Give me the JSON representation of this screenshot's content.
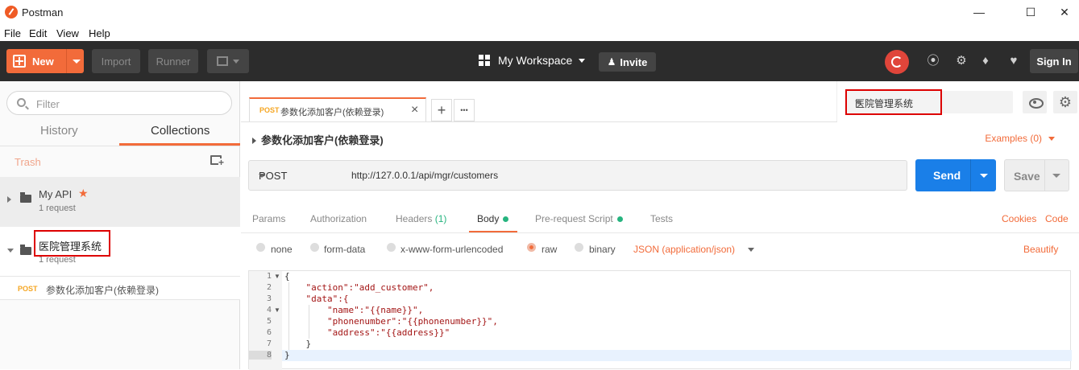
{
  "window": {
    "title": "Postman",
    "minimize_glyph": "—",
    "maximize_glyph": "☐",
    "close_glyph": "✕"
  },
  "menu": {
    "items": [
      "File",
      "Edit",
      "View",
      "Help"
    ]
  },
  "toolbar": {
    "new_label": "New",
    "import_label": "Import",
    "runner_label": "Runner",
    "workspace_label": "My Workspace",
    "invite_label": "Invite",
    "signin_label": "Sign In",
    "icons": [
      "sync-icon",
      "satellite-icon",
      "wrench-icon",
      "bell-icon",
      "heart-icon"
    ]
  },
  "sidebar": {
    "filter_placeholder": "Filter",
    "tabs": {
      "history": "History",
      "collections": "Collections",
      "active": "Collections"
    },
    "trash_label": "Trash",
    "collections": [
      {
        "name": "My API",
        "meta": "1 request",
        "starred": true,
        "expanded": false
      },
      {
        "name": "医院管理系统",
        "meta": "1 request",
        "starred": false,
        "expanded": true
      }
    ],
    "requests": [
      {
        "method": "POST",
        "name": "参数化添加客户(依赖登录)"
      }
    ]
  },
  "request_tab": {
    "method": "POST",
    "name": "参数化添加客户(依赖登录)",
    "close": "×",
    "new_tab": "+",
    "more": "•••"
  },
  "environment": {
    "selected": "医院管理系统"
  },
  "request": {
    "breadcrumb": "参数化添加客户(依赖登录)",
    "examples_label": "Examples (0)",
    "method": "POST",
    "url": "http://127.0.0.1/api/mgr/customers",
    "send_label": "Send",
    "save_label": "Save"
  },
  "request_tabs": {
    "params": "Params",
    "authorization": "Authorization",
    "headers": "Headers",
    "headers_count": "(1)",
    "body": "Body",
    "prerequest": "Pre-request Script",
    "tests": "Tests",
    "cookies": "Cookies",
    "code": "Code",
    "active": "Body"
  },
  "body_options": {
    "none": "none",
    "form_data": "form-data",
    "urlencoded": "x-www-form-urlencoded",
    "raw": "raw",
    "binary": "binary",
    "selected": "raw",
    "content_type": "JSON (application/json)",
    "beautify": "Beautify"
  },
  "editor": {
    "lines": [
      {
        "n": "1",
        "text": "{"
      },
      {
        "n": "2",
        "text": "    \"action\":\"add_customer\","
      },
      {
        "n": "3",
        "text": "    \"data\":{"
      },
      {
        "n": "4",
        "text": "        \"name\":\"{{name}}\","
      },
      {
        "n": "5",
        "text": "        \"phonenumber\":\"{{phonenumber}}\","
      },
      {
        "n": "6",
        "text": "        \"address\":\"{{address}}\""
      },
      {
        "n": "7",
        "text": "    }"
      },
      {
        "n": "8",
        "text": "}"
      }
    ],
    "active_line": 8
  },
  "colors": {
    "accent": "#f26b3a",
    "send": "#1a7fe8",
    "toolbar": "#2c2c2c",
    "highlight_box": "#dd0000"
  }
}
